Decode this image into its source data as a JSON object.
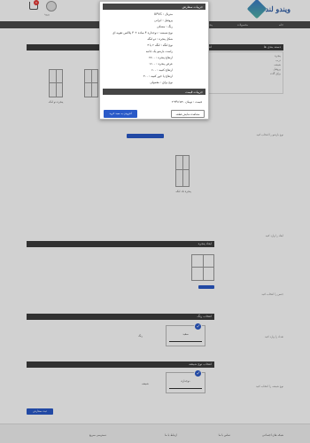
{
  "header": {
    "logo_text": "ویندو لند",
    "user_label": "ورود",
    "cart_count": "0"
  },
  "nav": {
    "items": [
      "خانه",
      "محصولات",
      "پنجره",
      "درب",
      "تماس"
    ]
  },
  "sidebar": {
    "title": "دسته بندی ها",
    "items": [
      "پنجره",
      "درب",
      "شیشه",
      "پروفیل",
      "یراق آلات"
    ],
    "labels": [
      "نوع بازشو را انتخاب کنید",
      "ابعاد را وارد کنید",
      "جنس را انتخاب کنید",
      "تعداد را وارد کنید",
      "نوع شیشه را انتخاب کنید"
    ]
  },
  "sections": {
    "s1_title": "انتخاب نوع پنجره",
    "s2_title": "ابعاد پنجره",
    "s3_title": "انتخاب رنگ",
    "s4_title": "انتخاب نوع شیشه",
    "win_caption_1": "پنجره دو لنگه",
    "win_caption_2": "پنجره تک لنگه",
    "option_1": "سفید",
    "option_2": "دوجداره",
    "side_text_1": "شیشه",
    "side_text_2": "رنگ",
    "submit_label": "ثبت سفارش"
  },
  "modal": {
    "spec_title": "جزییات سفارش",
    "specs": [
      "متریال : UPVC",
      "پروفیل : ایرانی",
      "رنگ : مشکی",
      "نوع شیشه : دوجداره ۴ ساده + ۴ پلاکس تقویه ای",
      "شکل پنجره : دو لنگه",
      "نوع لنگه : لنگه ۲ یا ۳",
      "راست بازشو یک جانبه",
      "ارتفاع پنجره : ۲۷۰۰",
      "عرض پنجره : ۱۶۰۰",
      "ارتفاع کتیبه : ۶۰۰",
      "ارتفاع پا خور کتیبه : ۳۰۰",
      "نوع یراق : معمولی"
    ],
    "price_title": "جزییات قیمت",
    "price_text": "قیمت : تومان ۲٬۳۴۸٬۵۳۰",
    "edit_button": "مشاهده نمایش قطعه",
    "buy_button": "افزودن به سبد خرید"
  },
  "footer": {
    "col1": "دسترسی سریع",
    "col2": "ارتباط با ما",
    "col3": "تماس با ما",
    "col4": "شبکه های اجتماعی"
  }
}
